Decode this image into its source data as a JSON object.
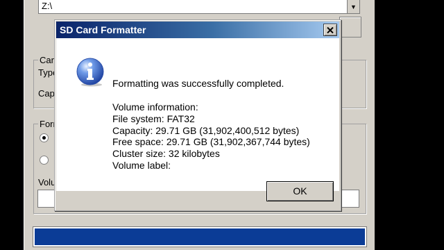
{
  "main_window": {
    "drive_value": "Z:\\",
    "card_legend": "Car",
    "card_type_label": "Type",
    "card_capacity_label": "Cap",
    "format_legend": "Forr",
    "volume_label": "Volu",
    "progress_fraction": 1.0
  },
  "dialog": {
    "title": "SD Card Formatter",
    "message": "Formatting was successfully completed.",
    "volume_info_header": "Volume information:",
    "file_system": "File system: FAT32",
    "capacity": "Capacity: 29.71 GB (31,902,400,512 bytes)",
    "free_space": "Free space: 29.71 GB (31,902,367,744 bytes)",
    "cluster_size": "Cluster size: 32 kilobytes",
    "volume_label": "Volume label:",
    "ok_label": "OK",
    "icon": "information-icon"
  },
  "colors": {
    "titlebar_start": "#0a246a",
    "titlebar_end": "#a6caf0",
    "progress": "#0b3c96"
  }
}
